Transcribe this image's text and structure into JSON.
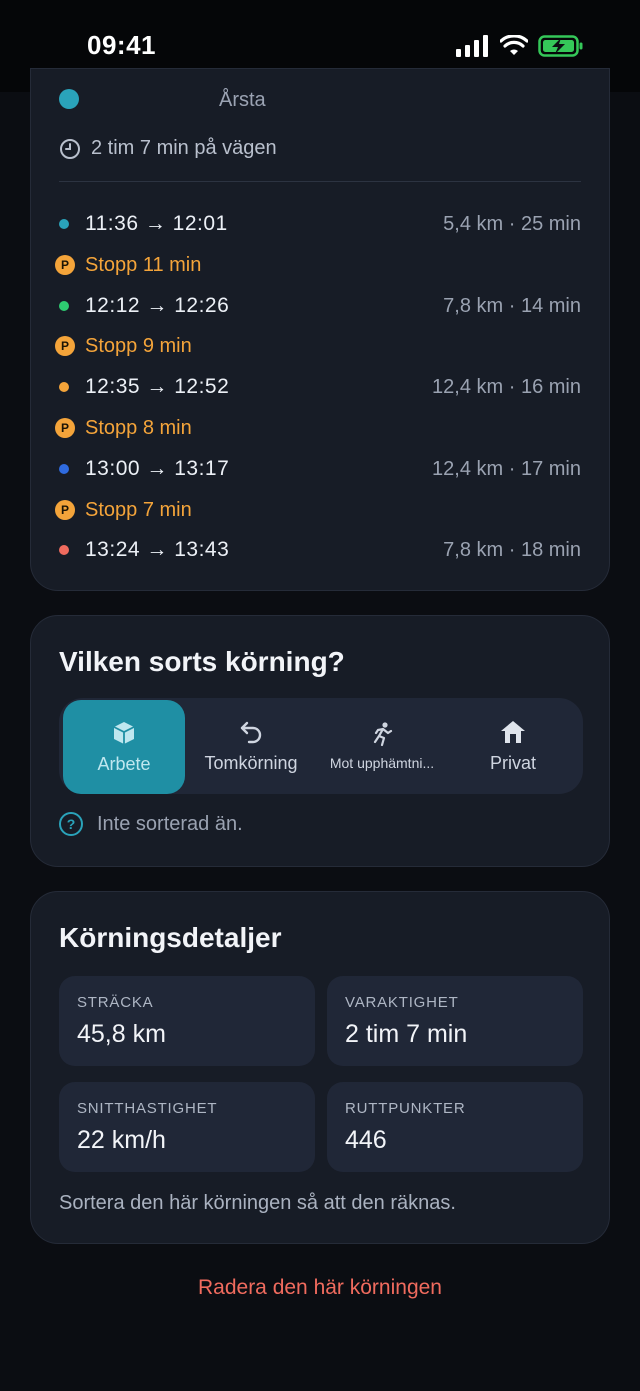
{
  "status_bar": {
    "time": "09:41"
  },
  "trip": {
    "top_place": "Årsta",
    "total": "2 tim 7 min på vägen",
    "segments": [
      {
        "times": "11:36 → 12:01",
        "meta": "5,4 km · 25 min",
        "color": "#2aa3ba"
      },
      {
        "times": "12:12 → 12:26",
        "meta": "7,8 km · 14 min",
        "color": "#2ecc71"
      },
      {
        "times": "12:35 → 12:52",
        "meta": "12,4 km · 16 min",
        "color": "#f4a43a"
      },
      {
        "times": "13:00 → 13:17",
        "meta": "12,4 km · 17 min",
        "color": "#2f6be0"
      },
      {
        "times": "13:24 → 13:43",
        "meta": "7,8 km · 18 min",
        "color": "#f06b5e"
      }
    ],
    "stops": [
      {
        "badge": "P",
        "label": "Stopp 11 min"
      },
      {
        "badge": "P",
        "label": "Stopp 9 min"
      },
      {
        "badge": "P",
        "label": "Stopp 8 min"
      },
      {
        "badge": "P",
        "label": "Stopp 7 min"
      }
    ]
  },
  "kind": {
    "title": "Vilken sorts körning?",
    "options": [
      {
        "label": "Arbete",
        "icon": "box-icon",
        "selected": true
      },
      {
        "label": "Tomkörning",
        "icon": "return-arrow-icon",
        "selected": false
      },
      {
        "label": "Mot upphämtni...",
        "icon": "running-person-icon",
        "selected": false
      },
      {
        "label": "Privat",
        "icon": "house-icon",
        "selected": false
      }
    ],
    "hint": "Inte sorterad än."
  },
  "details": {
    "title": "Körningsdetaljer",
    "tiles": [
      {
        "label": "STRÄCKA",
        "value": "45,8 km"
      },
      {
        "label": "VARAKTIGHET",
        "value": "2 tim 7 min"
      },
      {
        "label": "SNITTHASTIGHET",
        "value": "22 km/h"
      },
      {
        "label": "RUTTPUNKTER",
        "value": "446"
      }
    ],
    "note": "Sortera den här körningen så att den räknas."
  },
  "delete_label": "Radera den här körningen",
  "colors": {
    "accent": "#1f8fa4",
    "stop": "#f4a43a",
    "danger": "#f06b5e"
  }
}
